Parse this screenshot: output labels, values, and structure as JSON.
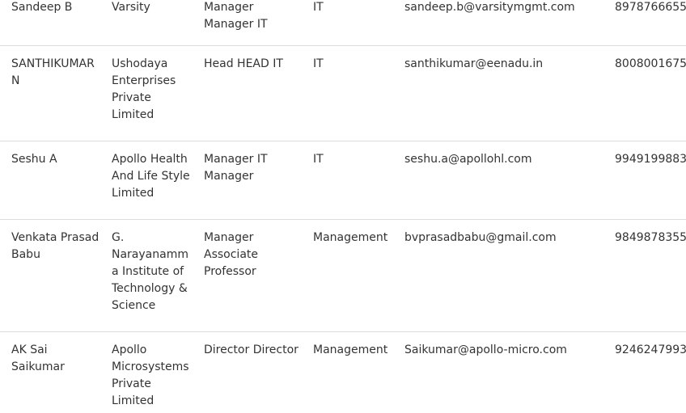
{
  "rows": [
    {
      "name": "Sandeep B",
      "organization": "Varsity",
      "designation": "Manager Manager IT",
      "department": "IT",
      "email": "sandeep.b@varsitymgmt.com",
      "phone": "8978766655"
    },
    {
      "name": "SANTHIKUMAR N",
      "organization": "Ushodaya Enterprises Private Limited",
      "designation": "Head HEAD IT",
      "department": "IT",
      "email": "santhikumar@eenadu.in",
      "phone": "8008001675"
    },
    {
      "name": "Seshu A",
      "organization": "Apollo Health And Life Style Limited",
      "designation": "Manager IT Manager",
      "department": "IT",
      "email": "seshu.a@apollohl.com",
      "phone": "9949199883"
    },
    {
      "name": "Venkata Prasad Babu",
      "organization": "G. Narayanamma Institute of Technology & Science",
      "designation": "Manager Associate Professor",
      "department": "Management",
      "email": "bvprasadbabu@gmail.com",
      "phone": "9849878355"
    },
    {
      "name": "AK Sai Saikumar",
      "organization": "Apollo Microsystems Private Limited",
      "designation": "Director Director",
      "department": "Management",
      "email": "Saikumar@apollo-micro.com",
      "phone": "9246247993"
    }
  ]
}
